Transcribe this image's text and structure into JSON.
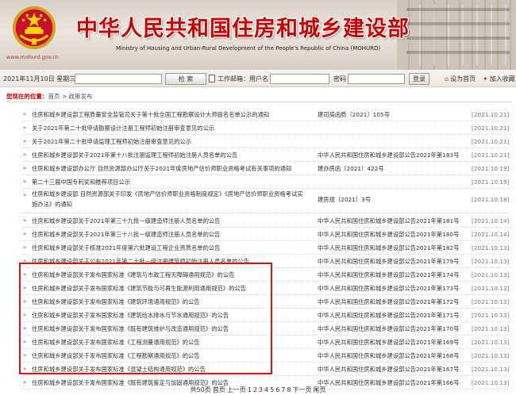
{
  "header": {
    "title": "中华人民共和国住房和城乡建设部",
    "subtitle": "Ministry of Housing and Urban-Rural Development of the People's Republic of China (MOHURD)",
    "url": "www.mohurd.gov.cn"
  },
  "topbar": {
    "date": "2021年11月10日 星期三",
    "search_button": "检 索",
    "work_platform_label": "工作邮箱：用户名",
    "password_label": "密码",
    "login_button": "登录",
    "home_link": "设为首页",
    "favorite_link": "加入收藏"
  },
  "breadcrumb": {
    "prefix": "您现在的位置：",
    "path": "首页 > 政策发布"
  },
  "items": [
    {
      "title": "住房和城乡建设部工程质量安全监管司关于第十批全国工程勘察设计大师提名名单公示的通知",
      "docno": "建司局函质〔2021〕105号",
      "date": "[2021.10.21]"
    },
    {
      "title": "关于2021年第二十批申请勘察设计注册工程师初始注册审查意见的公示",
      "docno": "",
      "date": "[2021.10.21]"
    },
    {
      "title": "关于2021年第二十批申请监理工程师初始注册审查意见的公示",
      "docno": "",
      "date": "[2021.10.21]"
    },
    {
      "title": "住房和城乡建设部关于2021年第十八批注册监理工程师初始注册人员名单的公告",
      "docno": "中华人民共和国住房和城乡建设部公告2021年第183号",
      "date": "[2021.10.21]"
    },
    {
      "title": "住房和城乡建设部办公厅 自然资源部办公厅关于2021年度房地产估价师职业资格考试有关事项的通知",
      "docno": "建办房函〔2021〕422号",
      "date": "[2021.10.19]"
    },
    {
      "title": "第二十三届中国专利奖和推荐项目公示",
      "docno": "",
      "date": "[2021.10.19]"
    },
    {
      "title": "住房和城乡建设部 自然资源部关于印发《房地产估价师职业资格制度规定》《房地产估价师职业资格考试实施办法》的通知",
      "docno": "建房规〔2021〕3号",
      "date": "[2021.10.18]"
    },
    {
      "title": "住房和城乡建设部关于2021年第三十九批一级建造师注册人员名单的公告",
      "docno": "中华人民共和国住房和城乡建设部公告2021年第181号",
      "date": "[2021.10.14]"
    },
    {
      "title": "住房和城乡建设部关于2021年第三十八批一级建造师注册人员名单的公告",
      "docno": "中华人民共和国住房和城乡建设部公告2021年第180号",
      "date": "[2021.10.14]"
    },
    {
      "title": "住房和城乡建设部关于核准2021年度第六批建设工程企业资质名单的公告",
      "docno": "中华人民共和国住房和城乡建设部公告2021年第182号",
      "date": "[2021.10.13]"
    },
    {
      "title": "住房和城乡建设部关于公布2021年第二十批一级注册建筑师初始注册人员名单的公告",
      "docno": "中华人民共和国住房和城乡建设部公告2021年第179号",
      "date": "[2021.10.13]"
    },
    {
      "title": "住房和城乡建设部关于发布国家标准《建筑与市政工程无障碍通用规范》的公告",
      "docno": "中华人民共和国住房和城乡建设部公告2021年第174号",
      "date": "[2021.10.13]"
    },
    {
      "title": "住房和城乡建设部关于发布国家标准《建筑节能与可再生能源利用通用规范》的公告",
      "docno": "中华人民共和国住房和城乡建设部公告2021年第173号",
      "date": "[2021.10.13]"
    },
    {
      "title": "住房和城乡建设部关于发布国家标准《建筑环境通用规范》的公告",
      "docno": "中华人民共和国住房和城乡建设部公告2021年第172号",
      "date": "[2021.10.13]"
    },
    {
      "title": "住房和城乡建设部关于发布国家标准《建筑给水排水与节水通用规范》的公告",
      "docno": "中华人民共和国住房和城乡建设部公告2021年第171号",
      "date": "[2021.10.13]"
    },
    {
      "title": "住房和城乡建设部关于发布国家标准《既有建筑维护与改造通用规范》的公告",
      "docno": "中华人民共和国住房和城乡建设部公告2021年第170号",
      "date": "[2021.10.13]"
    },
    {
      "title": "住房和城乡建设部关于发布国家标准《工程测量通用规范》的公告",
      "docno": "中华人民共和国住房和城乡建设部公告2021年第169号",
      "date": "[2021.10.13]"
    },
    {
      "title": "住房和城乡建设部关于发布国家标准《工程勘察通用规范》的公告",
      "docno": "中华人民共和国住房和城乡建设部公告2021年第168号",
      "date": "[2021.10.13]"
    },
    {
      "title": "住房和城乡建设部关于发布国家标准《混凝土结构通用规范》的公告",
      "docno": "中华人民共和国住房和城乡建设部公告2021年第167号",
      "date": "[2021.10.13]"
    },
    {
      "title": "住房和城乡建设部关于发布国家标准《既有建筑鉴定与加固通用规范》的公告",
      "docno": "中华人民共和国住房和城乡建设部公告2021年第166号",
      "date": "[2021.10.13]"
    }
  ],
  "pager": {
    "total": "共50页",
    "first": "首页",
    "prev": "上一页",
    "pages": [
      "1",
      "2",
      "3",
      "4",
      "5",
      "6",
      "7",
      "8"
    ],
    "current": "3",
    "next": "下一页",
    "last": "尾页"
  }
}
